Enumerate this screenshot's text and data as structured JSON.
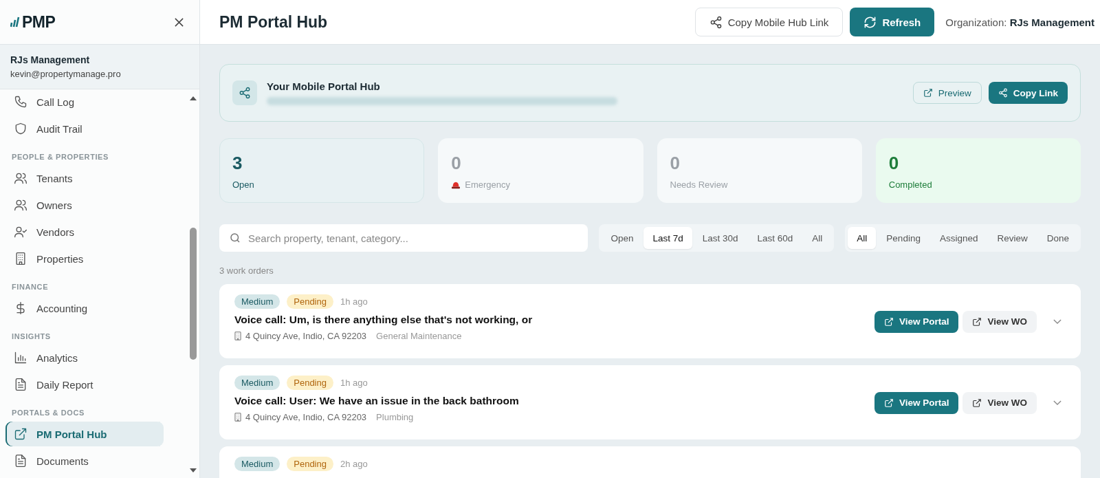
{
  "sidebar": {
    "logo": "PMP",
    "org_name": "RJs Management",
    "org_email": "kevin@propertymanage.pro",
    "nav": [
      {
        "kind": "item",
        "label": "Call Log",
        "selected": false
      },
      {
        "kind": "item",
        "label": "Audit Trail",
        "selected": false
      },
      {
        "kind": "section",
        "label": "PEOPLE & PROPERTIES"
      },
      {
        "kind": "item",
        "label": "Tenants",
        "selected": false
      },
      {
        "kind": "item",
        "label": "Owners",
        "selected": false
      },
      {
        "kind": "item",
        "label": "Vendors",
        "selected": false
      },
      {
        "kind": "item",
        "label": "Properties",
        "selected": false
      },
      {
        "kind": "section",
        "label": "FINANCE"
      },
      {
        "kind": "item",
        "label": "Accounting",
        "selected": false
      },
      {
        "kind": "section",
        "label": "INSIGHTS"
      },
      {
        "kind": "item",
        "label": "Analytics",
        "selected": false
      },
      {
        "kind": "item",
        "label": "Daily Report",
        "selected": false
      },
      {
        "kind": "section",
        "label": "PORTALS & DOCS"
      },
      {
        "kind": "item",
        "label": "PM Portal Hub",
        "selected": true
      },
      {
        "kind": "item",
        "label": "Documents",
        "selected": false
      }
    ]
  },
  "header": {
    "title": "PM Portal Hub",
    "copy_button": "Copy Mobile Hub Link",
    "refresh_button": "Refresh",
    "org_label": "Organization:",
    "org_value": "RJs Management"
  },
  "hub_banner": {
    "title": "Your Mobile Portal Hub",
    "preview_button": "Preview",
    "copy_button": "Copy Link"
  },
  "stats": [
    {
      "kind": "open",
      "value": "3",
      "label": "Open"
    },
    {
      "kind": "emergency",
      "value": "0",
      "label": "Emergency"
    },
    {
      "kind": "review",
      "value": "0",
      "label": "Needs Review"
    },
    {
      "kind": "completed",
      "value": "0",
      "label": "Completed"
    }
  ],
  "search": {
    "placeholder": "Search property, tenant, category..."
  },
  "period_tabs": [
    {
      "label": "Open",
      "selected": false
    },
    {
      "label": "Last 7d",
      "selected": true
    },
    {
      "label": "Last 30d",
      "selected": false
    },
    {
      "label": "Last 60d",
      "selected": false
    },
    {
      "label": "All",
      "selected": false
    }
  ],
  "status_tabs": [
    {
      "label": "All",
      "selected": true
    },
    {
      "label": "Pending",
      "selected": false
    },
    {
      "label": "Assigned",
      "selected": false
    },
    {
      "label": "Review",
      "selected": false
    },
    {
      "label": "Done",
      "selected": false
    }
  ],
  "count_label": "3 work orders",
  "work_orders": [
    {
      "priority": "Medium",
      "status": "Pending",
      "time": "1h ago",
      "title": "Voice call: Um, is there anything else that's not working, or",
      "address": "4 Quincy Ave, Indio, CA 92203",
      "category": "General Maintenance",
      "portal_button": "View Portal",
      "wo_button": "View WO"
    },
    {
      "priority": "Medium",
      "status": "Pending",
      "time": "1h ago",
      "title": "Voice call: User: We have an issue in the back bathroom",
      "address": "4 Quincy Ave, Indio, CA 92203",
      "category": "Plumbing",
      "portal_button": "View Portal",
      "wo_button": "View WO"
    },
    {
      "priority": "Medium",
      "status": "Pending",
      "time": "2h ago"
    }
  ]
}
